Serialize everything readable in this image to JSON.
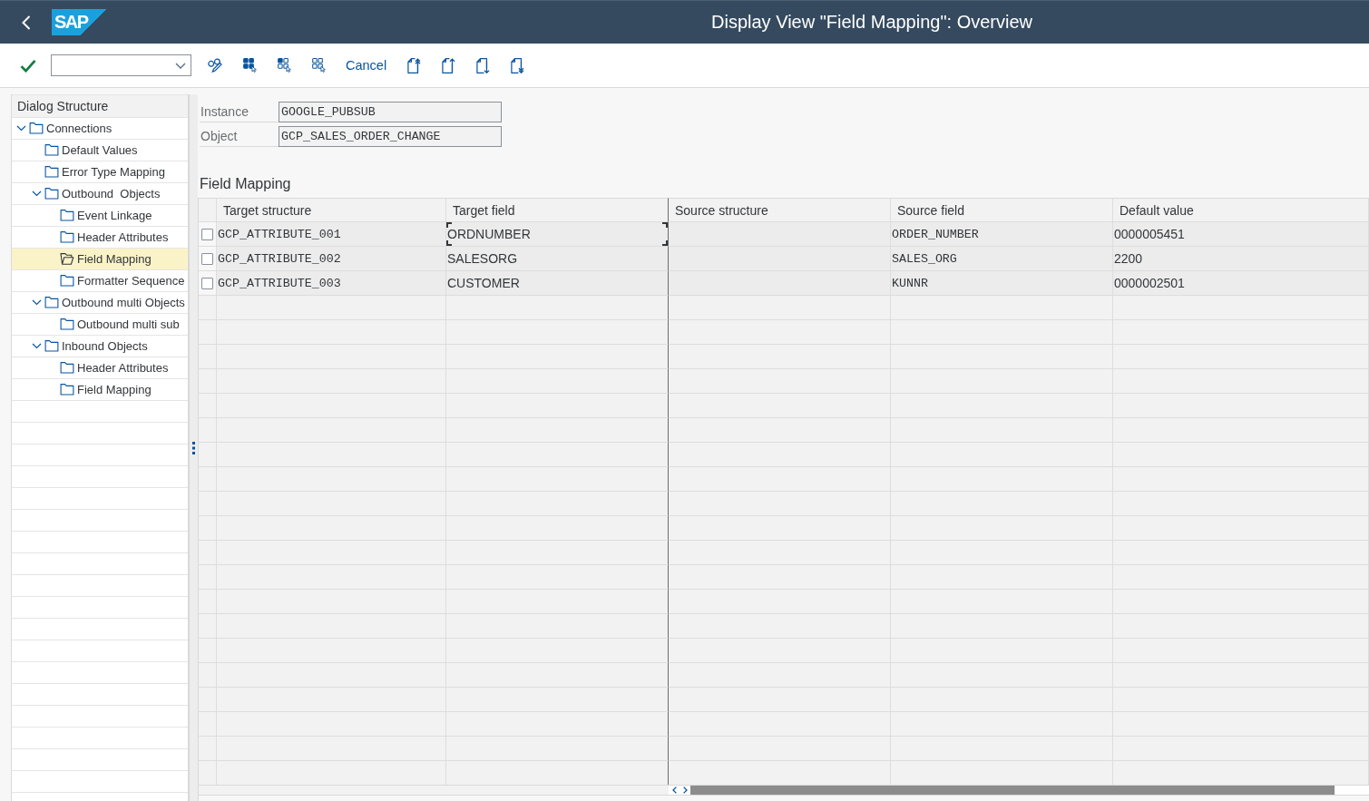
{
  "shell": {
    "logo": "SAP",
    "title": "Display View \"Field Mapping\": Overview"
  },
  "toolbar": {
    "cancel_button": "Cancel"
  },
  "dialog_structure": {
    "title": "Dialog Structure",
    "items": [
      {
        "label": "Connections",
        "expanded": true,
        "selected": false,
        "children": [
          {
            "label": "Default Values",
            "selected": false
          },
          {
            "label": "Error Type Mapping",
            "selected": false
          },
          {
            "label": "Outbound  Objects",
            "expanded": true,
            "selected": false,
            "children": [
              {
                "label": "Event Linkage",
                "selected": false
              },
              {
                "label": "Header Attributes",
                "selected": false
              },
              {
                "label": "Field Mapping",
                "selected": true
              },
              {
                "label": "Formatter Sequence",
                "selected": false
              }
            ]
          },
          {
            "label": "Outbound multi Objects",
            "expanded": true,
            "selected": false,
            "children": [
              {
                "label": "Outbound multi sub",
                "selected": false
              }
            ]
          },
          {
            "label": "Inbound Objects",
            "expanded": true,
            "selected": false,
            "children": [
              {
                "label": "Header Attributes",
                "selected": false
              },
              {
                "label": "Field Mapping",
                "selected": false
              }
            ]
          }
        ]
      }
    ]
  },
  "header_fields": [
    {
      "label": "Instance",
      "value": "GOOGLE_PUBSUB"
    },
    {
      "label": "Object",
      "value": "GCP_SALES_ORDER_CHANGE"
    }
  ],
  "section_title": "Field Mapping",
  "table": {
    "fixed_columns": [
      {
        "label": "Target structure",
        "kind": "code"
      },
      {
        "label": "Target field",
        "kind": "text"
      }
    ],
    "scrolling_columns": [
      {
        "label": "Source structure",
        "kind": "code"
      },
      {
        "label": "Source field",
        "kind": "code"
      },
      {
        "label": "Default value",
        "kind": "text"
      }
    ],
    "rows": [
      {
        "selected": false,
        "cells": [
          {
            "text": "GCP_ATTRIBUTE_001",
            "focused": false
          },
          {
            "text": "ORDNUMBER",
            "focused": true
          },
          {
            "focused": false
          },
          {
            "text": "ORDER_NUMBER",
            "focused": false
          },
          {
            "text": "0000005451",
            "focused": false
          }
        ]
      },
      {
        "selected": false,
        "cells": [
          {
            "text": "GCP_ATTRIBUTE_002",
            "focused": false
          },
          {
            "text": "SALESORG",
            "focused": false
          },
          {
            "focused": false
          },
          {
            "text": "SALES_ORG",
            "focused": false
          },
          {
            "text": "2200",
            "focused": false
          }
        ]
      },
      {
        "selected": false,
        "cells": [
          {
            "text": "GCP_ATTRIBUTE_003",
            "focused": false
          },
          {
            "text": "CUSTOMER",
            "focused": false
          },
          {
            "focused": false
          },
          {
            "text": "KUNNR",
            "focused": false
          },
          {
            "text": "0000002501",
            "focused": false
          }
        ]
      }
    ]
  }
}
